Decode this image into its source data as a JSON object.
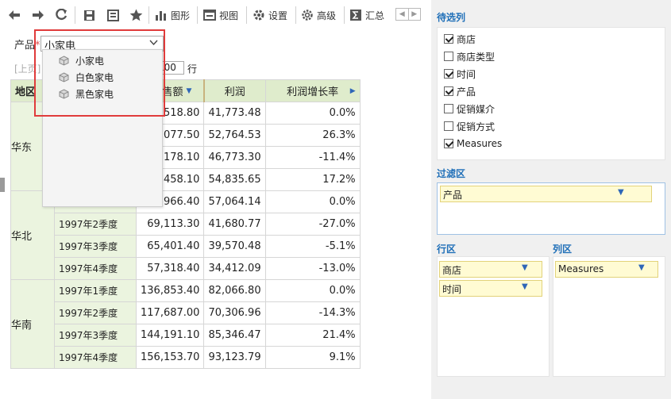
{
  "toolbar": {
    "chart_label": "图形",
    "view_label": "视图",
    "settings_label": "设置",
    "advanced_label": "高级",
    "summary_label": "汇总"
  },
  "filter": {
    "label": "产品",
    "required_mark": "*",
    "selected": "小家电",
    "options": [
      "小家电",
      "白色家电",
      "黑色家电"
    ]
  },
  "pager": {
    "prev": "[上页]",
    "page_size": "100",
    "unit": "行"
  },
  "table": {
    "headers": {
      "region": "地区",
      "sales_partial": "售额",
      "profit": "利润",
      "growth": "利润增长率"
    },
    "regions": [
      {
        "name": "华东",
        "rows": [
          {
            "time": "",
            "sales": "518.80",
            "profit": "41,773.48",
            "growth": "0.0%"
          },
          {
            "time": "",
            "sales": "077.50",
            "profit": "52,764.53",
            "growth": "26.3%"
          },
          {
            "time": "",
            "sales": "178.10",
            "profit": "46,773.30",
            "growth": "-11.4%"
          },
          {
            "time": "",
            "sales": "458.10",
            "profit": "54,835.65",
            "growth": "17.2%"
          }
        ]
      },
      {
        "name": "华北",
        "rows": [
          {
            "time": "",
            "sales": "966.40",
            "profit": "57,064.14",
            "growth": "0.0%"
          },
          {
            "time": "1997年2季度",
            "sales": "69,113.30",
            "profit": "41,680.77",
            "growth": "-27.0%"
          },
          {
            "time": "1997年3季度",
            "sales": "65,401.40",
            "profit": "39,570.48",
            "growth": "-5.1%"
          },
          {
            "time": "1997年4季度",
            "sales": "57,318.40",
            "profit": "34,412.09",
            "growth": "-13.0%"
          }
        ]
      },
      {
        "name": "华南",
        "rows": [
          {
            "time": "1997年1季度",
            "sales": "136,853.40",
            "profit": "82,066.80",
            "growth": "0.0%"
          },
          {
            "time": "1997年2季度",
            "sales": "117,687.00",
            "profit": "70,306.96",
            "growth": "-14.3%"
          },
          {
            "time": "1997年3季度",
            "sales": "144,191.10",
            "profit": "85,346.47",
            "growth": "21.4%"
          },
          {
            "time": "1997年4季度",
            "sales": "156,153.70",
            "profit": "93,123.79",
            "growth": "9.1%"
          }
        ]
      }
    ]
  },
  "panel": {
    "candidates_title": "待选列",
    "candidates": [
      {
        "label": "商店",
        "checked": true
      },
      {
        "label": "商店类型",
        "checked": false
      },
      {
        "label": "时间",
        "checked": true
      },
      {
        "label": "产品",
        "checked": true
      },
      {
        "label": "促销媒介",
        "checked": false
      },
      {
        "label": "促销方式",
        "checked": false
      },
      {
        "label": "Measures",
        "checked": true
      }
    ],
    "filter_title": "过滤区",
    "filter_fields": [
      "产品"
    ],
    "row_title": "行区",
    "row_fields": [
      "商店",
      "时间"
    ],
    "col_title": "列区",
    "col_fields": [
      "Measures"
    ]
  },
  "colors": {
    "header_bg": "#dfeccc",
    "dim_bg": "#ebf4df",
    "accent_blue": "#1f6fb8",
    "chip_bg": "#fffbd3",
    "highlight_red": "#e03b3b"
  }
}
